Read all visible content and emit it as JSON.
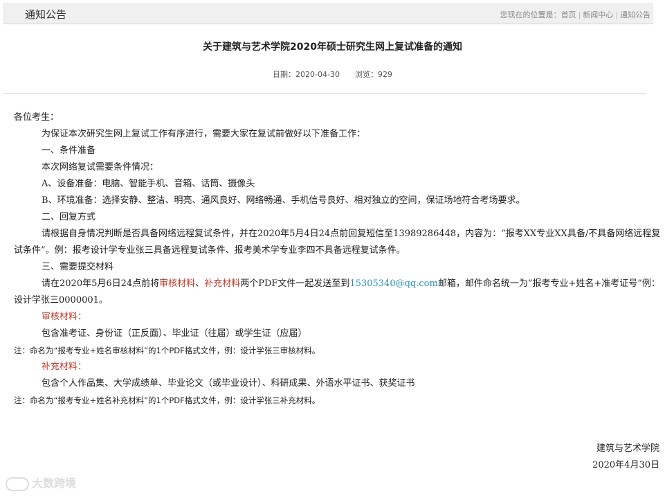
{
  "header": {
    "section_title": "通知公告",
    "breadcrumb": {
      "prefix": "您现在的位置是：",
      "items": [
        "首页",
        "新闻中心",
        "通知公告"
      ]
    }
  },
  "article": {
    "title": "关于建筑与艺术学院2020年硕士研究生网上复试准备的通知",
    "meta": {
      "date": "日期：2020-04-30",
      "views": "浏览：929"
    },
    "greeting": "各位考生：",
    "intro": "为保证本次研究生网上复试工作有序进行，需要大家在复试前做好以下准备工作：",
    "section1": {
      "heading": "一、条件准备",
      "lead": "本次网络复试需要条件情况：",
      "item_a": "A、设备准备：电脑、智能手机、音箱、话筒、摄像头",
      "item_b": "B、环境准备：选择安静、整洁、明亮、通风良好、网络畅通、手机信号良好、相对独立的空间，保证场地符合考场要求。"
    },
    "section2": {
      "heading": "二、回复方式",
      "text": "请根据自身情况判断是否具备网络远程复试条件，并在2020年5月4日24点前回复短信至13989286448，内容为：“报考XX专业XX具备/不具备网络远程复试条件”。例：报考设计学专业张三具备远程复试条件、报考美术学专业李四不具备远程复试条件。"
    },
    "section3": {
      "heading": "三、需要提交材料",
      "text_before": "请在2020年5月6日24点前将",
      "material_1": "审核材料",
      "mid_sep": "、",
      "material_2": "补充材料",
      "text_middle": "两个PDF文件一起发送至到",
      "email": "15305340@qq.com",
      "text_after": "邮箱，邮件命名统一为”报考专业+姓名+准考证号”例：设计学张三0000001。",
      "review_heading": "审核材料：",
      "review_items": "包含准考证、身份证（正反面）、毕业证（往届）或学生证（应届）",
      "review_note": "注：命名为“报考专业+姓名审核材料”的1个PDF格式文件，例：设计学张三审核材料。",
      "supp_heading": "补充材料：",
      "supp_items": "包含个人作品集、大学成绩单、毕业论文（或毕业设计）、科研成果、外语水平证书、获奖证书",
      "supp_note": "注：命名为“报考专业+姓名补充材料”的1个PDF格式文件，例：设计学张三补充材料。"
    },
    "signature": {
      "org": "建筑与艺术学院",
      "date": "2020年4月30日"
    }
  },
  "watermark": {
    "text": "大数跨境"
  },
  "colors": {
    "highlight_red": "#c0392b",
    "link_blue": "#2a8fbd",
    "header_bg": "#f0f0f0"
  }
}
